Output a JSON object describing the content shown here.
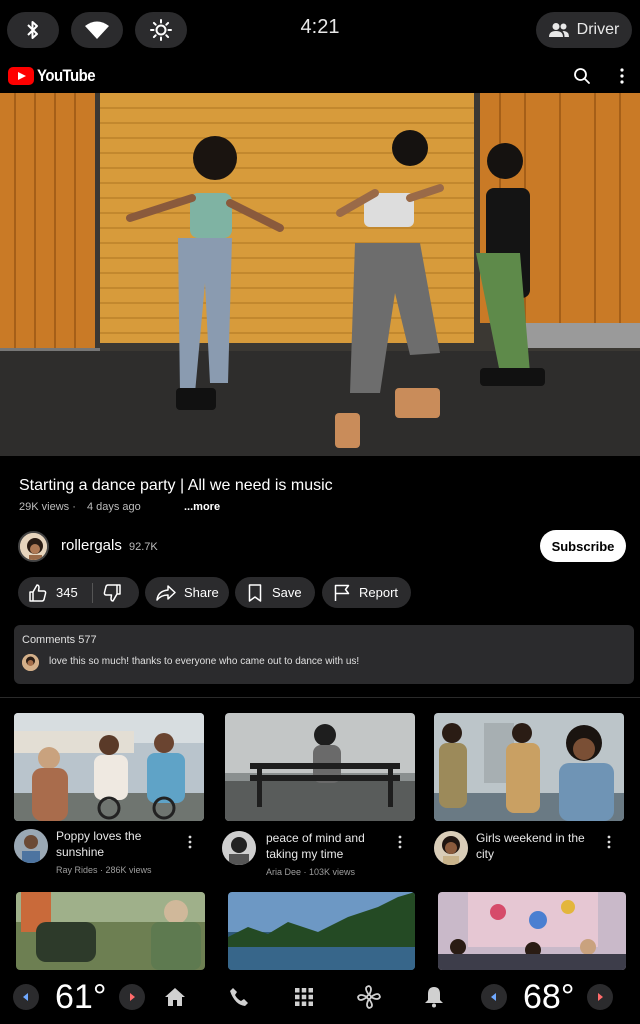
{
  "status_bar": {
    "time": "4:21",
    "profile_label": "Driver"
  },
  "app": {
    "logo_text": "YouTube"
  },
  "video": {
    "title": "Starting a dance party | All we need is music",
    "views": "29K views",
    "age": "4 days ago",
    "more_label": "...more",
    "channel": "rollergals",
    "subscribers": "92.7K",
    "subscribe_label": "Subscribe",
    "likes": "345",
    "share_label": "Share",
    "save_label": "Save",
    "report_label": "Report"
  },
  "comments": {
    "header": "Comments 577",
    "top_comment": "love this so much! thanks to everyone who came out to dance with us!"
  },
  "recommended": [
    {
      "title": "Poppy loves the sunshine",
      "channel": "Ray Rides",
      "views": "286K views"
    },
    {
      "title": "peace of mind and taking my time",
      "channel": "Aria Dee",
      "views": "103K views"
    },
    {
      "title": "Girls weekend in the city",
      "channel": "",
      "views": ""
    }
  ],
  "climate": {
    "driver_temp": "61°",
    "passenger_temp": "68°"
  },
  "icons": {
    "status": [
      "bluetooth-icon",
      "wifi-icon",
      "brightness-icon"
    ],
    "nav": [
      "home-icon",
      "phone-icon",
      "apps-grid-icon",
      "fan-icon",
      "bell-icon"
    ]
  },
  "colors": {
    "brand_red": "#ff0000",
    "surface": "#2b2b2d",
    "background": "#000000"
  }
}
